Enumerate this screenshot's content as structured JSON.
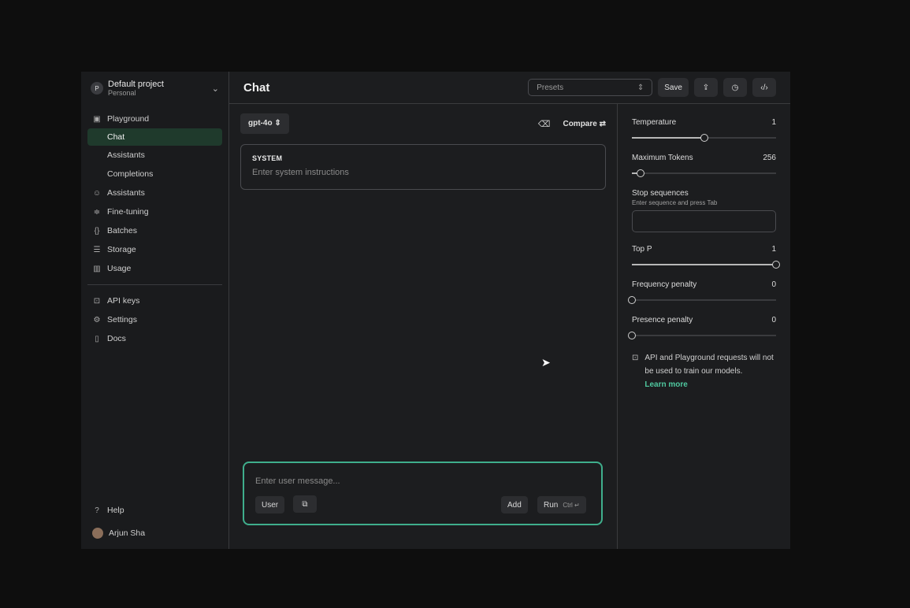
{
  "sidebar": {
    "project": {
      "avatar_letter": "P",
      "name": "Default project",
      "subtitle": "Personal"
    },
    "items": [
      {
        "label": "Playground",
        "icon": "terminal-icon"
      },
      {
        "label": "Chat",
        "active": true
      },
      {
        "label": "Assistants",
        "sub": true
      },
      {
        "label": "Completions",
        "sub": true
      },
      {
        "label": "Assistants",
        "icon": "robot-icon"
      },
      {
        "label": "Fine-tuning",
        "icon": "sliders-icon"
      },
      {
        "label": "Batches",
        "icon": "braces-icon"
      },
      {
        "label": "Storage",
        "icon": "database-icon"
      },
      {
        "label": "Usage",
        "icon": "bar-chart-icon"
      },
      {
        "label": "API keys",
        "icon": "lock-icon"
      },
      {
        "label": "Settings",
        "icon": "gear-icon"
      },
      {
        "label": "Docs",
        "icon": "doc-icon"
      }
    ],
    "help": "Help",
    "user": "Arjun Sha"
  },
  "header": {
    "title": "Chat",
    "presets_placeholder": "Presets",
    "save_label": "Save"
  },
  "chat": {
    "model": "gpt-4o",
    "compare_label": "Compare",
    "system_label": "SYSTEM",
    "system_placeholder": "Enter system instructions",
    "message_placeholder": "Enter user message...",
    "role_label": "User",
    "add_label": "Add",
    "run_label": "Run",
    "run_shortcut": "Ctrl ↵"
  },
  "settings": {
    "temperature": {
      "label": "Temperature",
      "value": "1",
      "fraction": 0.5
    },
    "max_tokens": {
      "label": "Maximum Tokens",
      "value": "256",
      "fraction": 0.06
    },
    "stop": {
      "label": "Stop sequences",
      "hint": "Enter sequence and press Tab"
    },
    "top_p": {
      "label": "Top P",
      "value": "1",
      "fraction": 1.0
    },
    "frequency": {
      "label": "Frequency penalty",
      "value": "0",
      "fraction": 0.0
    },
    "presence": {
      "label": "Presence penalty",
      "value": "0",
      "fraction": 0.0
    },
    "notice": "API and Playground requests will not be used to train our models.",
    "learn_more": "Learn more"
  }
}
